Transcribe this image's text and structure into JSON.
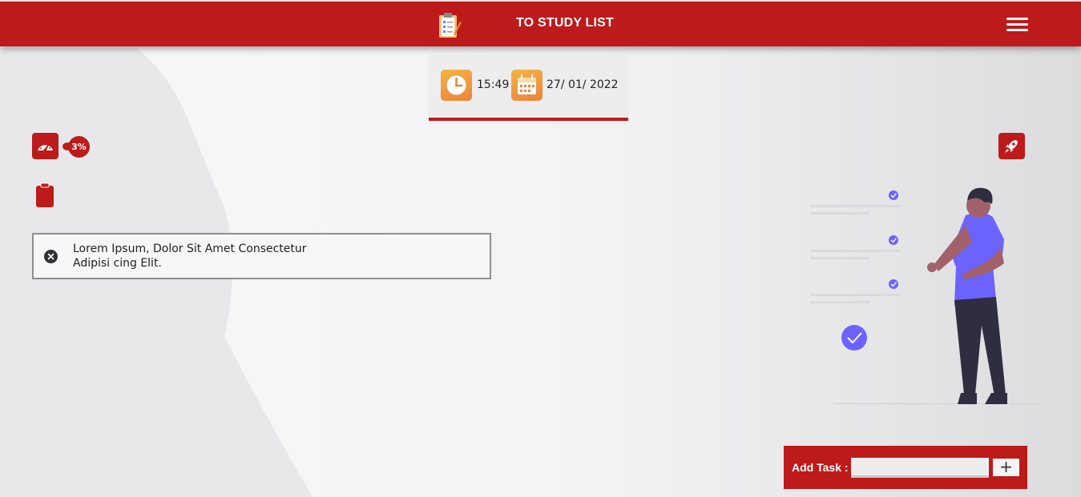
{
  "header": {
    "title": "TO STUDY LIST",
    "logo_icon": "clipboard-checklist-icon",
    "menu_icon": "hamburger-menu-icon",
    "color": "#bd1a1b"
  },
  "clock": {
    "time": "15:49",
    "date": "27/ 01/ 2022",
    "time_icon": "clock-icon",
    "date_icon": "calendar-icon"
  },
  "progress": {
    "icon": "speedometer-icon",
    "percent_label": "3%"
  },
  "rocket": {
    "icon": "rocket-icon"
  },
  "clipboard": {
    "icon": "clipboard-icon"
  },
  "tasks": [
    {
      "text": "Lorem Ipsum, Dolor Sit Amet Consectetur Adipisi cing Elit."
    }
  ],
  "add_task": {
    "label": "Add Task :",
    "input_value": "",
    "button_label": "+"
  }
}
